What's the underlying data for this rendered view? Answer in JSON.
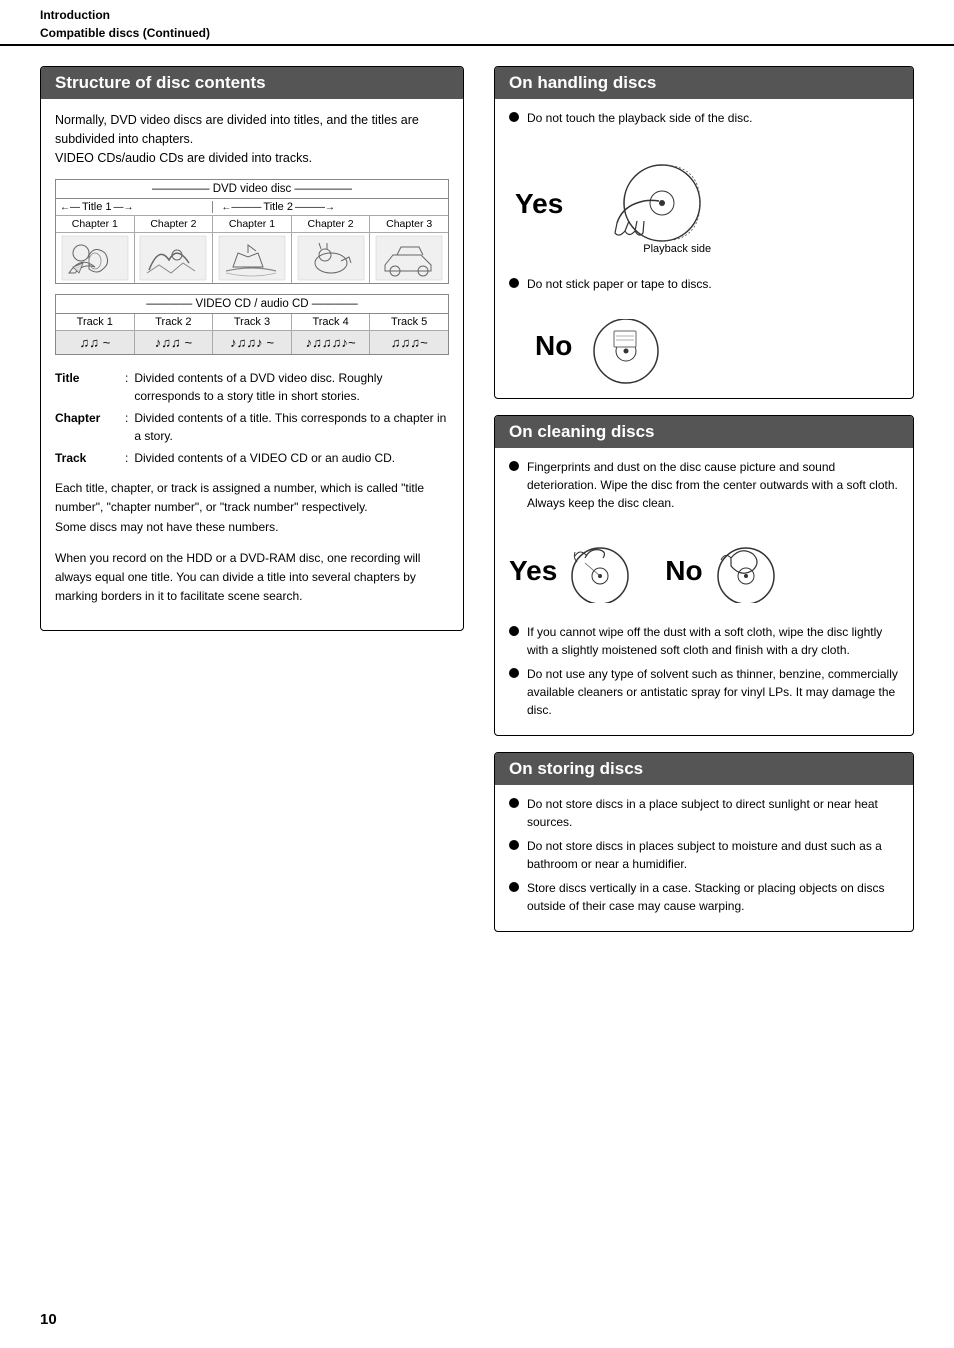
{
  "header": {
    "section": "Introduction",
    "subtitle": "Compatible discs (Continued)"
  },
  "left": {
    "section_title": "Structure of disc contents",
    "intro": [
      "Normally, DVD video discs are divided into titles, and the titles are subdivided into chapters.",
      "VIDEO CDs/audio CDs are divided into tracks."
    ],
    "dvd_diagram": {
      "title": "DVD video disc",
      "title1_label": "Title 1",
      "title2_label": "Title 2",
      "chapters": [
        "Chapter 1",
        "Chapter 2",
        "Chapter 1",
        "Chapter 2",
        "Chapter 3"
      ]
    },
    "vcd_diagram": {
      "title": "VIDEO CD / audio CD",
      "tracks": [
        "Track 1",
        "Track 2",
        "Track 3",
        "Track 4",
        "Track 5"
      ]
    },
    "definitions": [
      {
        "term": "Title",
        "desc": "Divided contents of a DVD video disc. Roughly corresponds to a story title in short stories."
      },
      {
        "term": "Chapter",
        "desc": "Divided contents of a title. This corresponds to a chapter in a story."
      },
      {
        "term": "Track",
        "desc": "Divided contents of a VIDEO CD or an audio CD."
      }
    ],
    "body1": "Each title, chapter, or track is assigned a number, which is called \"title number\", \"chapter number\", or \"track number\" respectively.\nSome discs may not have these numbers.",
    "body2": "When you record on the HDD or a DVD-RAM disc, one recording will always equal one title. You can divide a title into several chapters by marking borders in it to facilitate scene search."
  },
  "right": {
    "handling": {
      "title": "On handling discs",
      "bullets": [
        "Do not touch the playback side of the disc."
      ],
      "yes_label": "Yes",
      "playback_side_label": "Playback side",
      "bullet2": "Do not stick paper or tape to discs.",
      "no_label": "No"
    },
    "cleaning": {
      "title": "On cleaning discs",
      "bullets": [
        "Fingerprints and dust on the disc cause picture and sound deterioration. Wipe the disc from the center outwards with a soft cloth. Always keep the disc clean."
      ],
      "yes_label": "Yes",
      "no_label": "No",
      "bullets2": [
        "If you cannot wipe off the dust with a soft cloth, wipe the disc lightly with a slightly moistened soft cloth and finish with a dry cloth.",
        "Do not use any type of solvent such as thinner, benzine, commercially available cleaners or antistatic spray for vinyl LPs. It may damage the disc."
      ]
    },
    "storing": {
      "title": "On storing discs",
      "bullets": [
        "Do not store discs in a place subject to direct sunlight or near heat sources.",
        "Do not store discs in places subject to moisture and dust such as a bathroom or near a humidifier.",
        "Store discs vertically in a case. Stacking or placing objects on discs outside of their case may cause warping."
      ]
    }
  },
  "page_number": "10"
}
